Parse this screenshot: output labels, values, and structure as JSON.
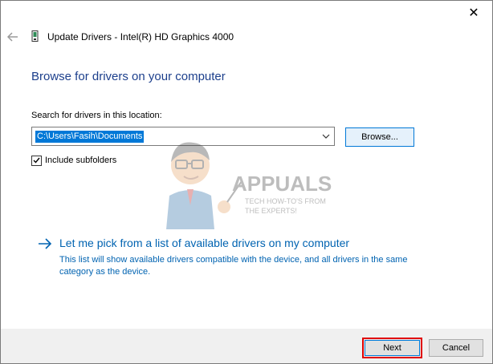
{
  "window": {
    "close_glyph": "✕"
  },
  "header": {
    "back_icon": "back-arrow-icon",
    "device_icon": "graphics-card-icon",
    "title": "Update Drivers - Intel(R) HD Graphics 4000"
  },
  "main": {
    "heading": "Browse for drivers on your computer",
    "search_label": "Search for drivers in this location:",
    "path_value": "C:\\Users\\Fasih\\Documents",
    "browse_label": "Browse...",
    "include_subfolders": {
      "label": "Include subfolders",
      "checked": true
    },
    "watermark": {
      "brand": "APPUALS",
      "tagline_1": "TECH HOW-TO'S FROM",
      "tagline_2": "THE EXPERTS!"
    },
    "pick_option": {
      "title": "Let me pick from a list of available drivers on my computer",
      "description": "This list will show available drivers compatible with the device, and all drivers in the same category as the device."
    }
  },
  "footer": {
    "next_label": "Next",
    "cancel_label": "Cancel"
  },
  "colors": {
    "accent": "#0078d7",
    "link": "#0063b1",
    "heading": "#1c3f8c",
    "highlight_border": "#e00000",
    "footer_bg": "#f0f0f0"
  }
}
